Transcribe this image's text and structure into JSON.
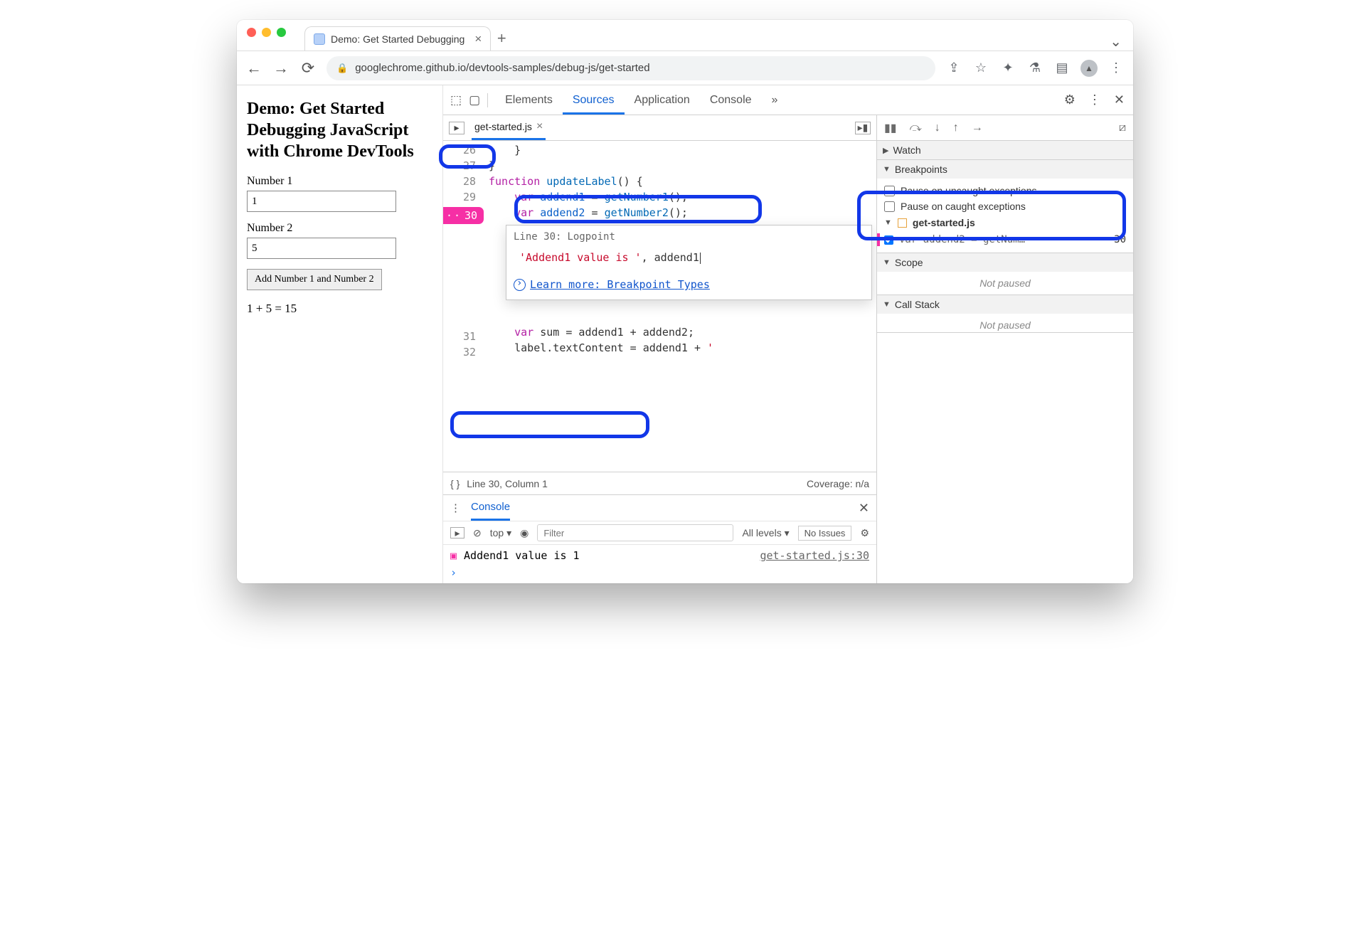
{
  "browser": {
    "tab_title": "Demo: Get Started Debugging",
    "url": "googlechrome.github.io/devtools-samples/debug-js/get-started"
  },
  "page": {
    "heading": "Demo: Get Started Debugging JavaScript with Chrome DevTools",
    "number1_label": "Number 1",
    "number1_value": "1",
    "number2_label": "Number 2",
    "number2_value": "5",
    "add_button": "Add Number 1 and Number 2",
    "result": "1 + 5 = 15"
  },
  "devtools": {
    "tabs": {
      "elements": "Elements",
      "sources": "Sources",
      "application": "Application",
      "console": "Console",
      "more": "»"
    },
    "source_file_tab": "get-started.js",
    "code": {
      "l26": "    }",
      "l27": "}",
      "l28_a": "function",
      "l28_b": " updateLabel",
      "l28_c": "() {",
      "l29_a": "    var",
      "l29_b": " addend1 ",
      "l29_c": "= ",
      "l29_d": "getNumber1",
      "l29_e": "();",
      "l30_a": "    var",
      "l30_b": " addend2 ",
      "l30_c": "= ",
      "l30_d": "getNumber2",
      "l30_e": "();",
      "l31": "    var sum = addend1 + addend2;",
      "l32": "    label.textContent = addend1 + ' "
    },
    "gutter": {
      "n26": "26",
      "n27": "27",
      "n28": "28",
      "n29": "29",
      "n30": "30",
      "n31": "31",
      "n32": "32"
    },
    "logpoint_badge": "30",
    "logpoint": {
      "line_label": "Line 30:",
      "type": "Logpoint",
      "expr_str": "'Addend1 value is '",
      "expr_rest": ", addend1",
      "learn_more": "Learn more: Breakpoint Types"
    },
    "status": {
      "fmt": "{ }",
      "pos": "Line 30, Column 1",
      "coverage": "Coverage: n/a"
    },
    "debugger": {
      "watch": "Watch",
      "breakpoints": "Breakpoints",
      "bp_uncaught": "Pause on uncaught exceptions",
      "bp_caught": "Pause on caught exceptions",
      "bp_file": "get-started.js",
      "bp_line_code": "var addend2 = getNum…",
      "bp_line_num": "30",
      "scope": "Scope",
      "callstack": "Call Stack",
      "not_paused": "Not paused"
    },
    "drawer": {
      "tab": "Console",
      "context": "top ▾",
      "filter_placeholder": "Filter",
      "levels": "All levels ▾",
      "issues": "No Issues",
      "log_msg": "Addend1 value is  1",
      "log_src": "get-started.js:30"
    }
  }
}
